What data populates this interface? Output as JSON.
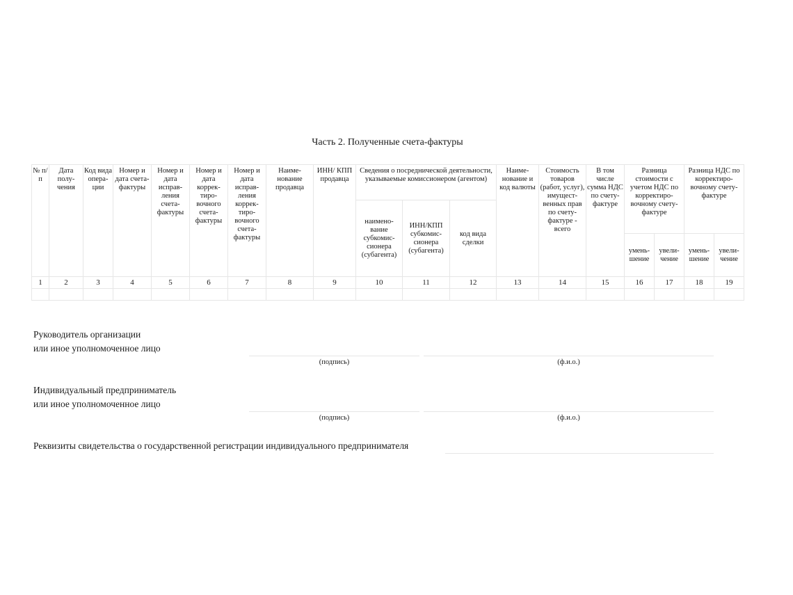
{
  "title": "Часть 2. Полученные счета-фактуры",
  "table": {
    "headers": {
      "c1": "№ п/п",
      "c2": "Дата полу-чения",
      "c3": "Код вида опера-ции",
      "c4": "Номер и дата счета-фактуры",
      "c5": "Номер и дата исправ-ления счета-фактуры",
      "c6": "Номер и дата коррек-тиро-вочного счета-фактуры",
      "c7": "Номер и дата исправ-ления коррек-тиро-вочного счета-фактуры",
      "c8": "Наиме-нование продавца",
      "c9": "ИНН/ КПП продавца",
      "c10_12_group": "Сведения о посреднической деятельности, указываемые комиссионером (агентом)",
      "c10": "наимено-вание субкомис-сионера (субагента)",
      "c11": "ИНН/КПП субкомис-сионера (субагента)",
      "c12": "код вида сделки",
      "c13": "Наиме-нование и код валюты",
      "c14": "Стоимость товаров (работ, услуг), имущест-венных прав по счету-фактуре - всего",
      "c15": "В том числе сумма НДС по счету-фактуре",
      "c16_17_group": "Разница стоимости с учетом НДС по корректиро-вочному счету-фактуре",
      "c18_19_group": "Разница НДС по корректиро-вочному счету-фактуре",
      "c16": "умень-шение",
      "c17": "увели-чение",
      "c18": "умень-шение",
      "c19": "увели-чение"
    },
    "column_numbers": [
      "1",
      "2",
      "3",
      "4",
      "5",
      "6",
      "7",
      "8",
      "9",
      "10",
      "11",
      "12",
      "13",
      "14",
      "15",
      "16",
      "17",
      "18",
      "19"
    ],
    "empty_row": [
      "",
      "",
      "",
      "",
      "",
      "",
      "",
      "",
      "",
      "",
      "",
      "",
      "",
      "",
      "",
      "",
      "",
      "",
      ""
    ]
  },
  "signatures": {
    "head": {
      "line1": "Руководитель организации",
      "line2": "или иное уполномоченное лицо",
      "sign_caption": "(подпись)",
      "name_caption": "(ф.и.о.)"
    },
    "entrepreneur": {
      "line1": "Индивидуальный предприниматель",
      "line2": "или иное уполномоченное лицо",
      "sign_caption": "(подпись)",
      "name_caption": "(ф.и.о.)"
    },
    "registration": {
      "label": "Реквизиты свидетельства о государственной регистрации индивидуального предпринимателя"
    }
  }
}
